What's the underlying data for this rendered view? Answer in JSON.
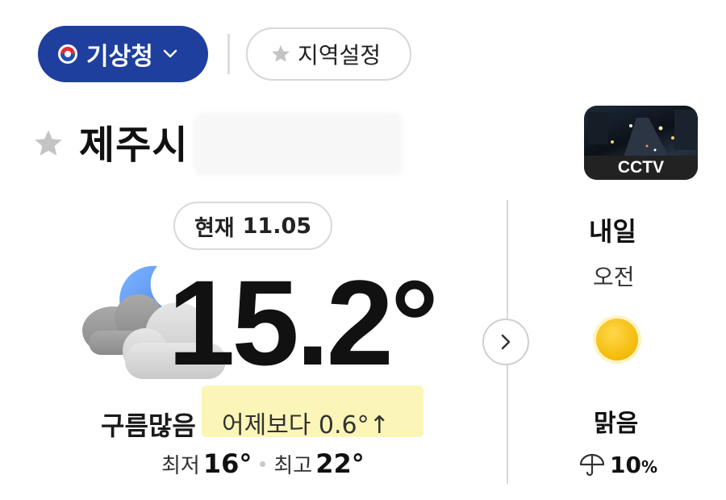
{
  "header": {
    "agency_label": "기상청",
    "region_button_label": "지역설정"
  },
  "location": {
    "city": "제주시"
  },
  "cctv": {
    "label": "CCTV"
  },
  "current": {
    "time_label": "현재",
    "time_value": "11.05",
    "temperature": "15.2°",
    "condition": "구름많음",
    "compare_text": "어제보다 0.6°↑",
    "min_label": "최저",
    "min_value": "16°",
    "max_label": "최고",
    "max_value": "22°"
  },
  "tomorrow": {
    "title": "내일",
    "period": "오전",
    "condition": "맑음",
    "rain_value": "10",
    "rain_unit": "%"
  },
  "colors": {
    "brand_blue": "#1f3f9e",
    "highlight": "#fbf6b8",
    "sun": "#f7c400"
  },
  "icons": [
    "kma-logo-icon",
    "chevron-down-icon",
    "star-icon",
    "favorite-star-icon",
    "cctv-thumbnail",
    "partly-cloudy-night-icon",
    "chevron-right-icon",
    "sun-icon",
    "umbrella-icon"
  ]
}
